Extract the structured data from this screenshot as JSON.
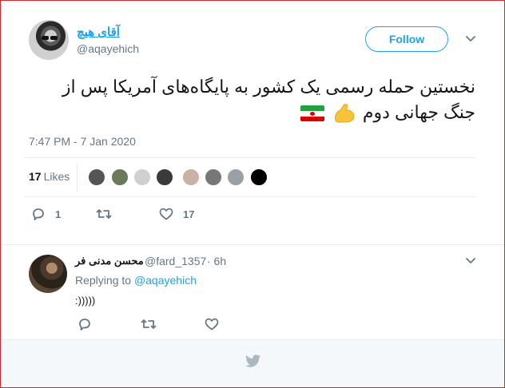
{
  "tweet": {
    "author_name": "آقای هیچ",
    "author_handle": "@aqayehich",
    "follow_label": "Follow",
    "text_line1": "نخستین حمله رسمی یک کشور به پایگاه‌های آمریکا پس از",
    "text_line2": "جنگ جهانی دوم",
    "emoji_icons": [
      "flexed-biceps-icon",
      "iran-flag-icon"
    ],
    "timestamp": "7:47 PM - 7 Jan 2020",
    "likes_count": "17",
    "likes_label": "Likes",
    "liker_avatar_colors": [
      "#555555",
      "#6b7a5a",
      "#d0d0d0",
      "#3a3a3a",
      "#c9b1a4",
      "#777777",
      "#9aa0a8",
      "#000000"
    ],
    "reply_count": "1",
    "retweet_count": "",
    "like_count": "17"
  },
  "reply": {
    "author_name": "محسن مدنی فر",
    "author_handle": "@fard_1357",
    "time": "· 6h",
    "replying_prefix": "Replying to",
    "replying_to": "@aqayehich",
    "text": ":)))))"
  },
  "colors": {
    "accent": "#1da1f2",
    "muted": "#657786",
    "frame_border": "#d9252b",
    "footer_bg": "#f5f8fa"
  }
}
